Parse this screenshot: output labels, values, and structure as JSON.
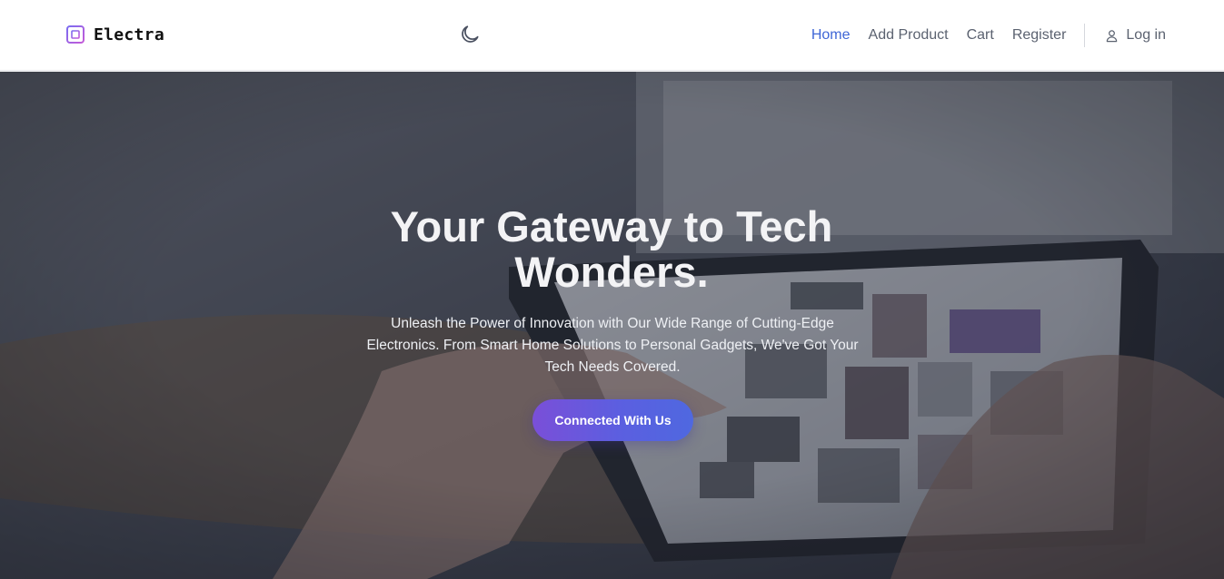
{
  "brand": {
    "name": "Electra",
    "icon": "cpu-chip-icon"
  },
  "theme_toggle": {
    "icon": "moon-icon"
  },
  "nav": {
    "items": [
      {
        "label": "Home",
        "active": true
      },
      {
        "label": "Add Product",
        "active": false
      },
      {
        "label": "Cart",
        "active": false
      },
      {
        "label": "Register",
        "active": false
      }
    ],
    "login": {
      "label": "Log in",
      "icon": "user-icon"
    }
  },
  "hero": {
    "title": "Your Gateway to Tech Wonders.",
    "subtitle": "Unleash the Power of Innovation with Our Wide Range of Cutting-Edge Electronics. From Smart Home Solutions to Personal Gadgets, We've Got Your Tech Needs Covered.",
    "cta_label": "Connected With Us",
    "background": "hands-holding-tablet-image"
  },
  "colors": {
    "accent": "#3f66d6",
    "cta_gradient_start": "#7a4fd8",
    "cta_gradient_end": "#4f68e0",
    "nav_text": "#5b6270",
    "hero_overlay": "#282c3a"
  }
}
